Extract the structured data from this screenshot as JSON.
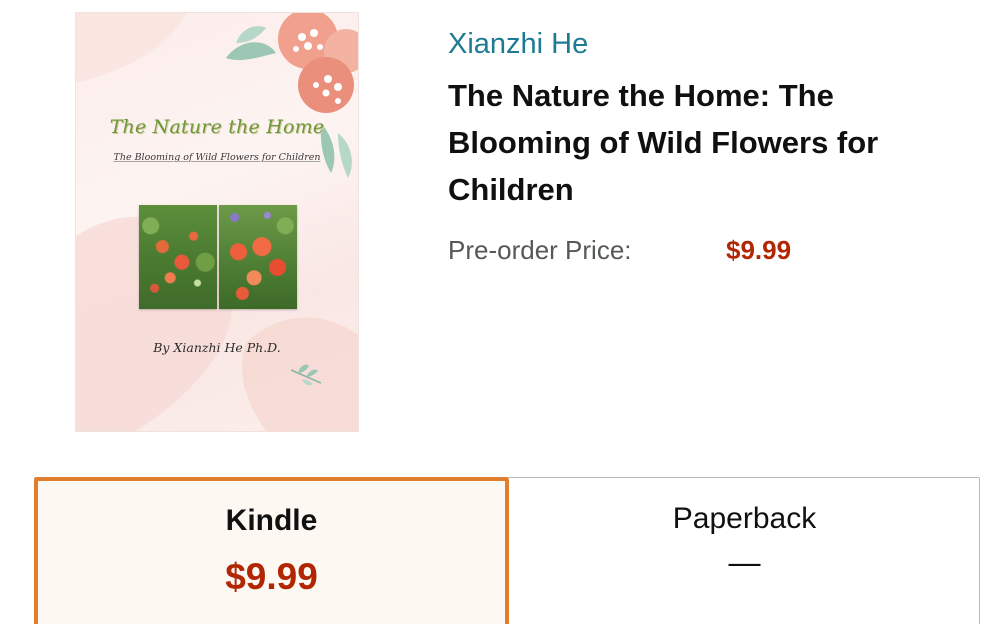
{
  "product": {
    "author": "Xianzhi He",
    "title": "The Nature the Home: The Blooming of Wild Flowers for Children",
    "price_label": "Pre-order Price:",
    "price_value": "$9.99"
  },
  "cover": {
    "title": "The Nature the Home",
    "subtitle": "The Blooming of Wild Flowers for Children",
    "author": "By Xianzhi He Ph.D."
  },
  "formats": [
    {
      "name": "Kindle",
      "price": "$9.99",
      "selected": true
    },
    {
      "name": "Paperback",
      "price": "—",
      "selected": false
    }
  ],
  "colors": {
    "author_link": "#1e7b93",
    "price": "#b12704",
    "selected_border": "#e07e2e",
    "selected_background": "#fef8f2",
    "text": "#0f1111",
    "muted_text": "#565959"
  }
}
